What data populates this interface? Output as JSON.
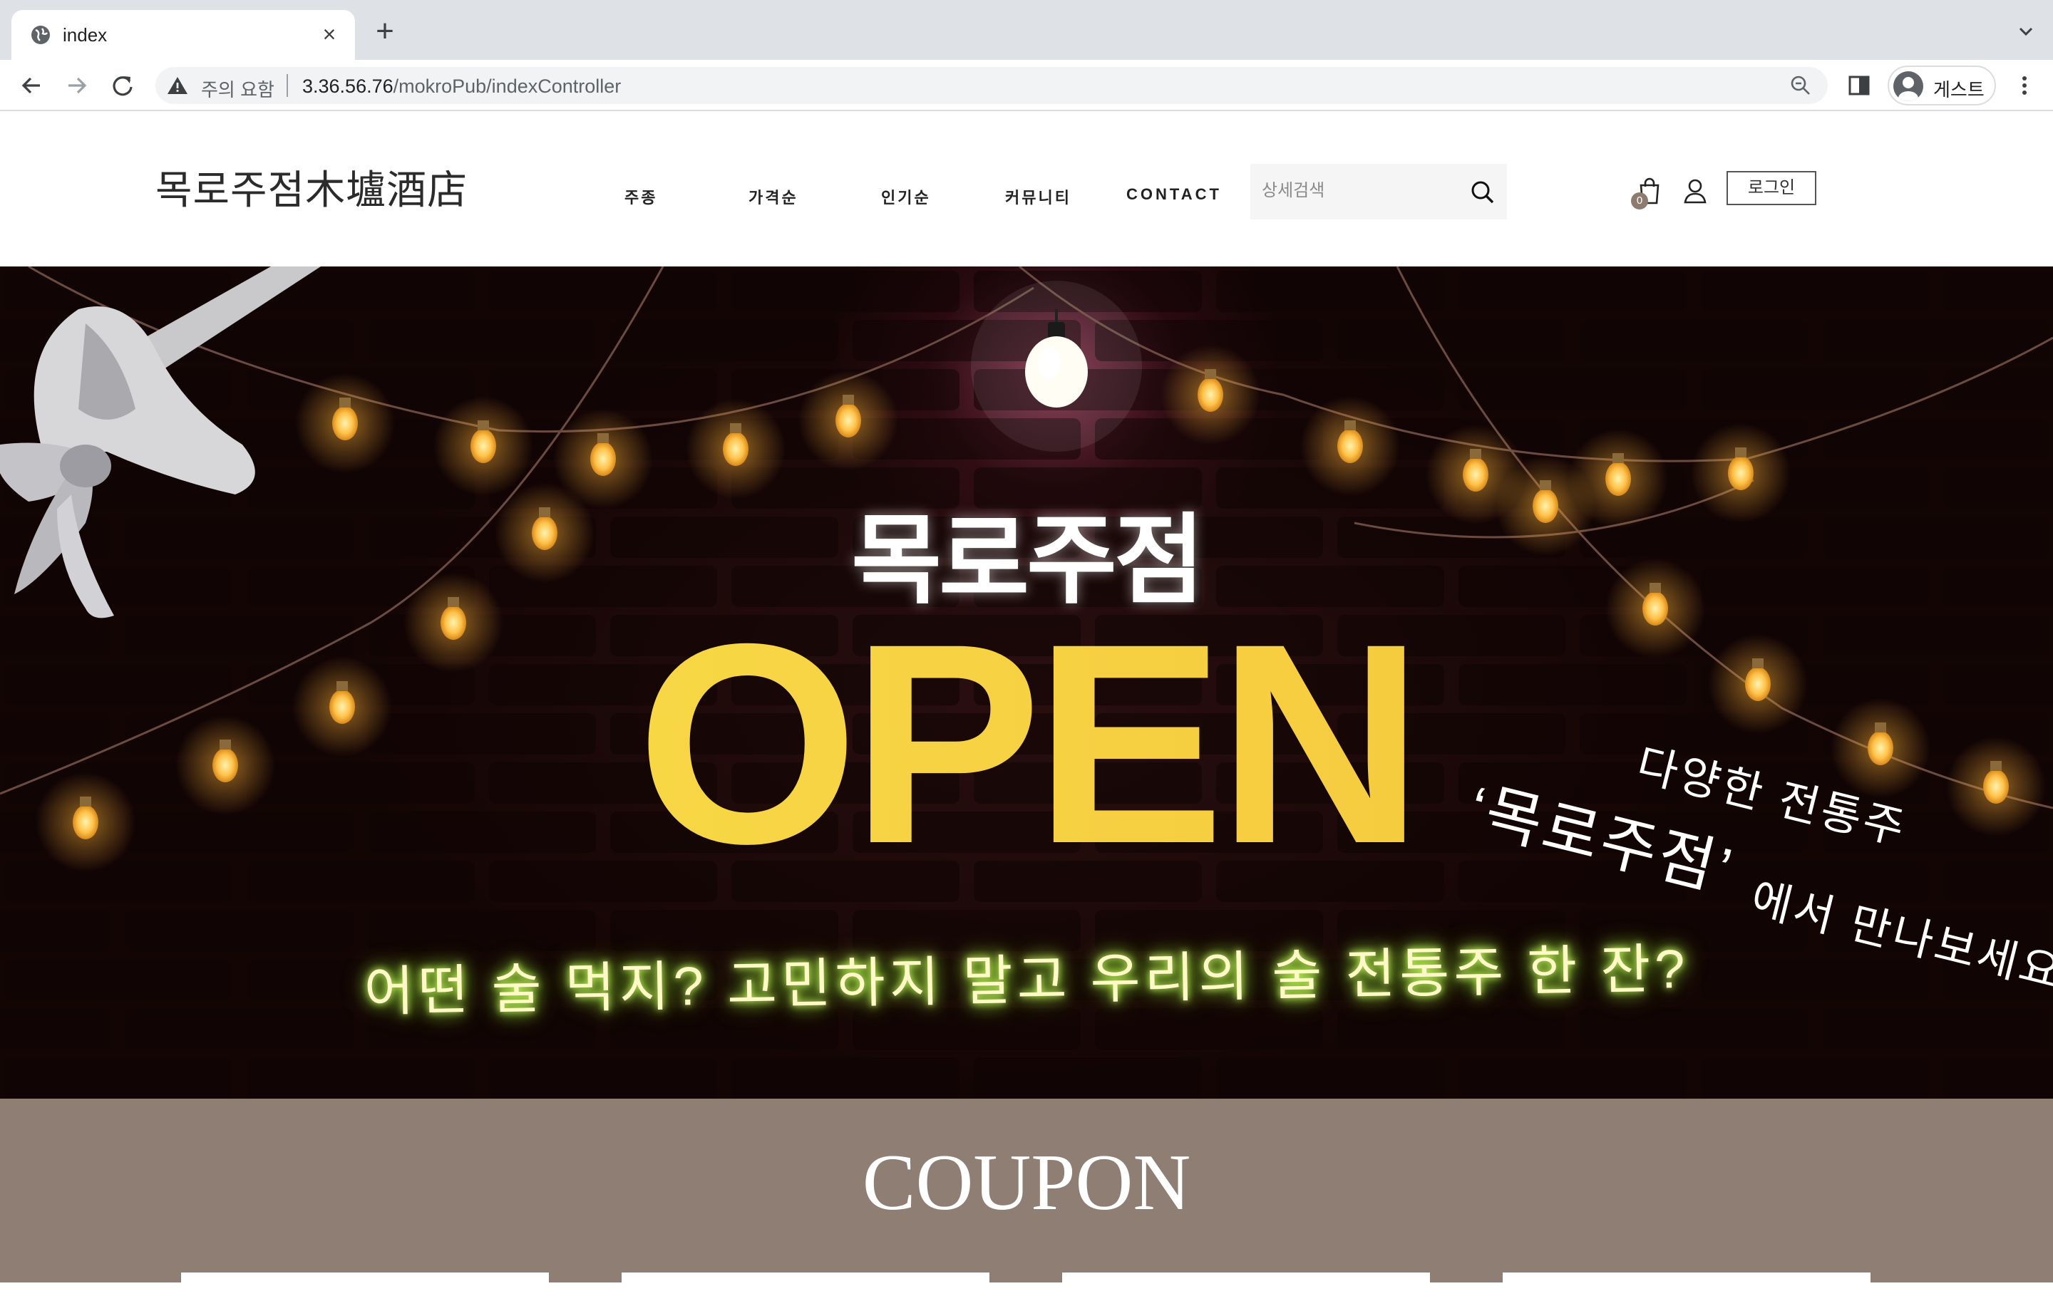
{
  "browser": {
    "tab_title": "index",
    "warning_label": "주의 요함",
    "url_host": "3.36.56.76",
    "url_path": "/mokroPub/indexController",
    "profile_label": "게스트"
  },
  "header": {
    "logo": "목로주점木壚酒店",
    "nav": [
      "주종",
      "가격순",
      "인기순",
      "커뮤니티",
      "CONTACT"
    ],
    "search_placeholder": "상세검색",
    "cart_count": "0",
    "login_label": "로그인"
  },
  "hero": {
    "title": "목로주점",
    "open": "OPEN",
    "subtitle": "어떤 술 먹지? 고민하지 말고 우리의 술 전통주 한 잔?",
    "script_top": "다양한 전통주",
    "script_main": "‘목로주점’",
    "script_bottom": "에서 만나보세요",
    "colors": {
      "open_start": "#f9e04a",
      "open_end": "#f4c33a",
      "neon": "#cfff6a",
      "bulb": "#ffb43a"
    }
  },
  "coupon": {
    "title": "COUPON",
    "background": "#8f7e73"
  }
}
